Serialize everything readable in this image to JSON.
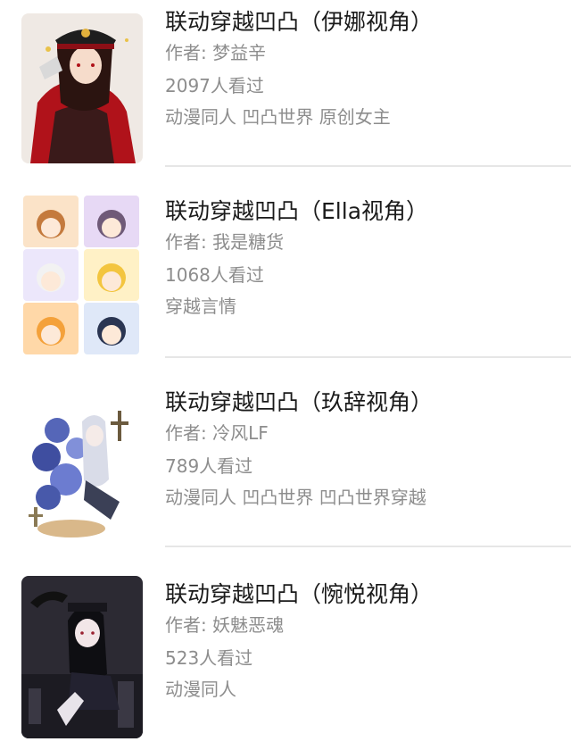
{
  "books": [
    {
      "title": "联动穿越凹凸（伊娜视角）",
      "author": "作者: 梦益辛",
      "views": "2097人看过",
      "tags": "动漫同人 凹凸世界 原创女主"
    },
    {
      "title": "联动穿越凹凸（Ella视角）",
      "author": "作者: 我是糖货",
      "views": "1068人看过",
      "tags": "穿越言情"
    },
    {
      "title": "联动穿越凹凸（玖辞视角）",
      "author": "作者: 冷风LF",
      "views": "789人看过",
      "tags": "动漫同人 凹凸世界 凹凸世界穿越"
    },
    {
      "title": "联动穿越凹凸（惋悦视角）",
      "author": "作者: 妖魅恶魂",
      "views": "523人看过",
      "tags": "动漫同人"
    }
  ]
}
